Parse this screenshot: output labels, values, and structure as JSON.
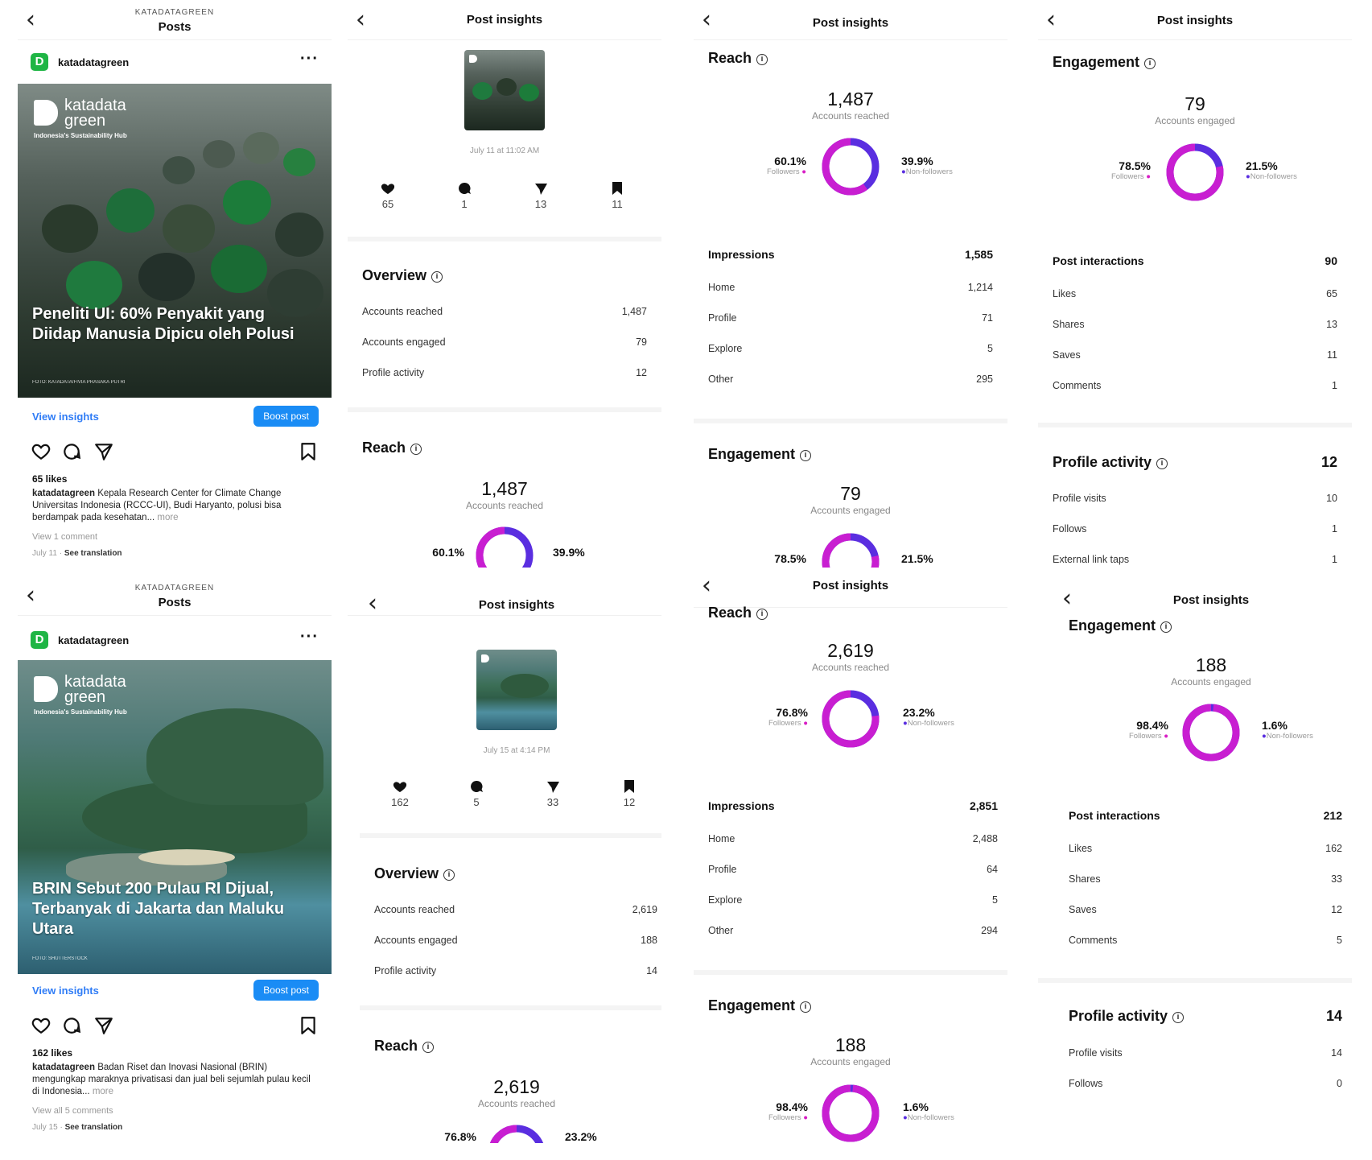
{
  "colors": {
    "followers": "#c81ed1",
    "non_followers": "#5a2ee0",
    "link": "#2f7cf6",
    "boost": "#1a8cf5",
    "brand": "#1fb545"
  },
  "common": {
    "back_icon": "chevron-left-icon",
    "info_icon": "info-icon",
    "post_insights_title": "Post insights",
    "posts_title": "Posts",
    "account_caps": "KATADATAGREEN",
    "account": "katadatagreen",
    "view_insights": "View insights",
    "boost_post": "Boost post",
    "see_translation": "See translation",
    "overview": "Overview",
    "reach": "Reach",
    "engagement": "Engagement",
    "impressions": "Impressions",
    "post_interactions": "Post interactions",
    "profile_activity": "Profile activity",
    "accounts_reached": "Accounts reached",
    "accounts_engaged": "Accounts engaged",
    "followers": "Followers",
    "non_followers": "Non-followers",
    "home": "Home",
    "profile": "Profile",
    "explore": "Explore",
    "other": "Other",
    "likes": "Likes",
    "shares": "Shares",
    "saves": "Saves",
    "comments": "Comments",
    "profile_visits": "Profile visits",
    "follows": "Follows",
    "external_link_taps": "External link taps"
  },
  "post1": {
    "brand_name": "katadata green",
    "brand_tag": "Indonesia's Sustainability Hub",
    "headline": "Peneliti UI: 60% Penyakit yang Diidap Manusia Dipicu oleh Polusi",
    "credit": "FOTO: KATADATA/FIVIA PRASAKA PUTRI",
    "likes": "65 likes",
    "caption_rest": "Kepala Research Center for Climate Change Universitas Indonesia (RCCC-UI), Budi Haryanto, polusi bisa berdampak pada kesehatan...",
    "more": "more",
    "comments": "View 1 comment",
    "date": "July 11",
    "insights_date": "July 11 at 11:02 AM",
    "stats": {
      "likes": "65",
      "comments": "1",
      "shares": "13",
      "saves": "11"
    },
    "overview": {
      "accounts_reached": "1,487",
      "accounts_engaged": "79",
      "profile_activity": "12"
    },
    "reach": {
      "total": "1,487",
      "followers_pct": 60.1,
      "followers_label": "60.1%",
      "non_followers_label": "39.9%"
    },
    "impressions": {
      "total": "1,585",
      "home": "1,214",
      "profile": "71",
      "explore": "5",
      "other": "295"
    },
    "engagement": {
      "total": "79",
      "followers_pct": 78.5,
      "followers_label": "78.5%",
      "non_followers_label": "21.5%"
    },
    "interactions": {
      "total": "90",
      "likes": "65",
      "shares": "13",
      "saves": "11",
      "comments": "1"
    },
    "profile_activity": {
      "total": "12",
      "profile_visits": "10",
      "follows": "1",
      "external_link_taps": "1"
    }
  },
  "post2": {
    "brand_name": "katadata green",
    "brand_tag": "Indonesia's Sustainability Hub",
    "headline": "BRIN Sebut 200 Pulau RI Dijual, Terbanyak di Jakarta dan Maluku Utara",
    "credit": "FOTO: SHUTTERSTOCK",
    "likes": "162 likes",
    "caption_rest": "Badan Riset dan Inovasi Nasional (BRIN) mengungkap maraknya privatisasi dan jual beli sejumlah pulau kecil di Indonesia...",
    "more": "more",
    "comments": "View all 5 comments",
    "date": "July 15",
    "insights_date": "July 15 at 4:14 PM",
    "stats": {
      "likes": "162",
      "comments": "5",
      "shares": "33",
      "saves": "12"
    },
    "overview": {
      "accounts_reached": "2,619",
      "accounts_engaged": "188",
      "profile_activity": "14"
    },
    "reach": {
      "total": "2,619",
      "followers_pct": 76.8,
      "followers_label": "76.8%",
      "non_followers_label": "23.2%"
    },
    "impressions": {
      "total": "2,851",
      "home": "2,488",
      "profile": "64",
      "explore": "5",
      "other": "294"
    },
    "engagement": {
      "total": "188",
      "followers_pct": 98.4,
      "followers_label": "98.4%",
      "non_followers_label": "1.6%"
    },
    "interactions": {
      "total": "212",
      "likes": "162",
      "shares": "33",
      "saves": "12",
      "comments": "5"
    },
    "profile_activity": {
      "total": "14",
      "profile_visits": "14",
      "follows": "0"
    }
  }
}
